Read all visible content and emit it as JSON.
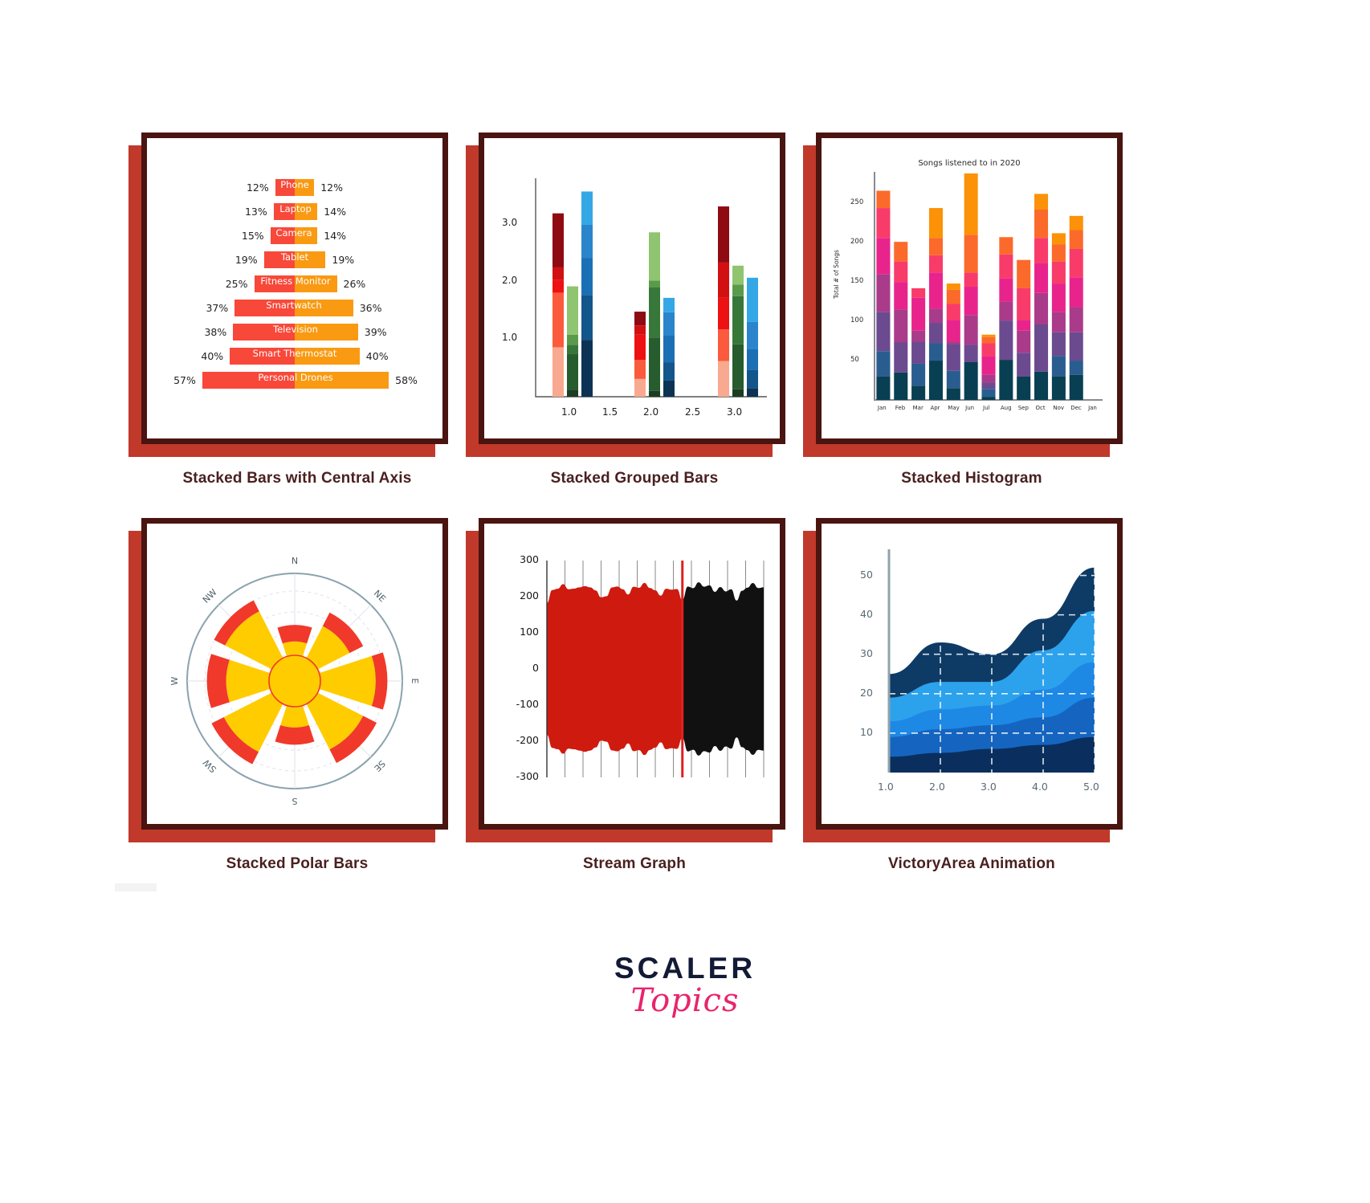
{
  "page": {
    "background": "#ffffff",
    "frame_color": "#4a1410",
    "shadow_color": "#c0392b",
    "caption_color": "#4a2020"
  },
  "logo": {
    "primary": "SCALER",
    "secondary": "Topics",
    "primary_color": "#121a35",
    "secondary_color": "#e8246c"
  },
  "cards": [
    {
      "caption": "Stacked Bars with Central Axis"
    },
    {
      "caption": "Stacked Grouped Bars"
    },
    {
      "caption": "Stacked Histogram"
    },
    {
      "caption": "Stacked Polar Bars"
    },
    {
      "caption": "Stream Graph"
    },
    {
      "caption": "VictoryArea Animation"
    }
  ],
  "chart_data": [
    {
      "type": "bar",
      "title": "Stacked Bars with Central Axis",
      "orientation": "horizontal-diverging",
      "categories": [
        "Phone",
        "Laptop",
        "Camera",
        "Tablet",
        "Fitness Monitor",
        "Smartwatch",
        "Television",
        "Smart Thermostat",
        "Personal Drones"
      ],
      "series": [
        {
          "name": "left",
          "color": "#f8483a",
          "values": [
            12,
            13,
            15,
            19,
            25,
            37,
            38,
            40,
            57
          ]
        },
        {
          "name": "right",
          "color": "#f99a12",
          "values": [
            12,
            14,
            14,
            19,
            26,
            36,
            39,
            40,
            58
          ]
        }
      ],
      "left_labels": [
        "12%",
        "13%",
        "15%",
        "19%",
        "25%",
        "37%",
        "38%",
        "40%",
        "57%"
      ],
      "right_labels": [
        "12%",
        "14%",
        "14%",
        "19%",
        "26%",
        "36%",
        "39%",
        "40%",
        "58%"
      ],
      "xlabel": "",
      "ylabel": "",
      "grid": false,
      "legend": "none"
    },
    {
      "type": "bar",
      "title": "Stacked Grouped Bars",
      "xlabel": "",
      "ylabel": "",
      "x_ticks": [
        "1.0",
        "1.5",
        "2.0",
        "2.5",
        "3.0"
      ],
      "y_ticks": [
        "1.0",
        "2.0",
        "3.0"
      ],
      "ylim": [
        0,
        3.8
      ],
      "grid": false,
      "legend": "none",
      "groups": [
        {
          "x": "1.0",
          "bars": [
            {
              "name": "red",
              "segments": [
                0.86,
                0.95,
                0.22,
                0.22,
                0.94
              ],
              "colors": [
                "#f9a98f",
                "#fb5a3c",
                "#ee1111",
                "#d21012",
                "#8e0b12"
              ]
            },
            {
              "name": "green",
              "segments": [
                0.12,
                0.62,
                0.16,
                0.18,
                0.84
              ],
              "colors": [
                "#1b3d23",
                "#265c2e",
                "#37783a",
                "#5a9b4b",
                "#8fc470"
              ]
            },
            {
              "name": "blue",
              "segments": [
                0.99,
                0.78,
                0.64,
                0.58,
                0.58
              ],
              "colors": [
                "#0d3354",
                "#13568b",
                "#1b6fb5",
                "#2a85cc",
                "#34a8e6"
              ]
            }
          ]
        },
        {
          "x": "2.0",
          "bars": [
            {
              "name": "red",
              "segments": [
                0.31,
                0.33,
                0.44,
                0.16,
                0.24
              ],
              "colors": [
                "#f9a98f",
                "#fb5a3c",
                "#ee1111",
                "#d21012",
                "#8e0b12"
              ]
            },
            {
              "name": "green",
              "segments": [
                0.1,
                0.92,
                0.88,
                0.12,
                0.84
              ],
              "colors": [
                "#1b3d23",
                "#265c2e",
                "#37783a",
                "#5a9b4b",
                "#8fc470"
              ]
            },
            {
              "name": "blue",
              "segments": [
                0.28,
                0.32,
                0.47,
                0.4,
                0.25
              ],
              "colors": [
                "#0d3354",
                "#13568b",
                "#1b6fb5",
                "#2a85cc",
                "#34a8e6"
              ]
            }
          ]
        },
        {
          "x": "3.0",
          "bars": [
            {
              "name": "red",
              "segments": [
                0.62,
                0.55,
                0.55,
                0.62,
                0.97
              ],
              "colors": [
                "#f9a98f",
                "#fb5a3c",
                "#ee1111",
                "#d21012",
                "#8e0b12"
              ]
            },
            {
              "name": "green",
              "segments": [
                0.13,
                0.78,
                0.84,
                0.2,
                0.33
              ],
              "colors": [
                "#1b3d23",
                "#265c2e",
                "#37783a",
                "#5a9b4b",
                "#8fc470"
              ]
            },
            {
              "name": "blue",
              "segments": [
                0.15,
                0.32,
                0.36,
                0.47,
                0.77
              ],
              "colors": [
                "#0d3354",
                "#13568b",
                "#1b6fb5",
                "#2a85cc",
                "#34a8e6"
              ]
            }
          ]
        }
      ]
    },
    {
      "type": "bar",
      "title": "Songs listened to in 2020",
      "ylabel": "Total # of Songs",
      "xlabel": "",
      "categories": [
        "Jan",
        "Feb",
        "Mar",
        "Apr",
        "May",
        "Jun",
        "Jul",
        "Aug",
        "Sep",
        "Oct",
        "Nov",
        "Dec",
        "Jan"
      ],
      "y_ticks": [
        "50",
        "100",
        "150",
        "200",
        "250"
      ],
      "ylim": [
        0,
        290
      ],
      "grid": false,
      "legend": "none",
      "stack_colors": [
        "#093f52",
        "#2a5d8f",
        "#6b4a8f",
        "#a93b8a",
        "#e8248c",
        "#f93b6a",
        "#fb6a2a",
        "#fb9208"
      ],
      "stacks": [
        [
          30,
          32,
          50,
          48,
          46,
          38,
          22,
          0
        ],
        [
          35,
          0,
          38,
          42,
          35,
          26,
          25,
          0
        ],
        [
          18,
          28,
          28,
          14,
          42,
          12,
          0,
          0
        ],
        [
          50,
          22,
          26,
          18,
          46,
          22,
          22,
          38
        ],
        [
          15,
          22,
          34,
          3,
          28,
          20,
          18,
          8
        ],
        [
          48,
          0,
          22,
          38,
          36,
          18,
          48,
          78
        ],
        [
          4,
          10,
          8,
          10,
          24,
          16,
          8,
          3
        ],
        [
          51,
          0,
          50,
          24,
          30,
          30,
          22,
          0
        ],
        [
          30,
          0,
          30,
          28,
          14,
          40,
          36,
          0
        ],
        [
          36,
          0,
          60,
          40,
          38,
          32,
          36,
          20
        ],
        [
          30,
          26,
          30,
          26,
          36,
          28,
          22,
          14
        ],
        [
          32,
          18,
          36,
          32,
          38,
          36,
          24,
          18
        ],
        [
          0,
          0,
          0,
          0,
          0,
          0,
          0,
          0
        ]
      ]
    },
    {
      "type": "bar",
      "title": "Stacked Polar Bars",
      "coordinate": "polar",
      "directions": [
        "N",
        "NE",
        "E",
        "SE",
        "S",
        "SW",
        "W",
        "NW"
      ],
      "series": [
        {
          "name": "inner",
          "color": "#ffcc00",
          "values": [
            0.2,
            0.52,
            0.8,
            0.74,
            0.3,
            0.78,
            0.62,
            0.76
          ]
        },
        {
          "name": "outer",
          "color": "#f0392b",
          "values": [
            0.24,
            0.22,
            0.17,
            0.22,
            0.25,
            0.2,
            0.28,
            0.18
          ]
        }
      ],
      "grid": true,
      "legend": "none"
    },
    {
      "type": "area",
      "title": "Stream Graph",
      "y_ticks": [
        "300",
        "200",
        "100",
        "0",
        "-100",
        "-200",
        "-300"
      ],
      "ylim": [
        -300,
        300
      ],
      "xlabel": "",
      "ylabel": "",
      "grid": true,
      "legend": "none",
      "marker_line_color": "#e02020",
      "palette_left": [
        "#cf1a0f",
        "#f23a10",
        "#f7e04a",
        "#a5d44a",
        "#4fae4a",
        "#1d8a6e",
        "#10695c",
        "#0c5046"
      ],
      "palette_right": [
        "#111111",
        "#2d2d2d",
        "#4a4a4a",
        "#6b6b6b",
        "#8a8a8a",
        "#ababab",
        "#cccccc",
        "#eeeeee"
      ]
    },
    {
      "type": "area",
      "title": "VictoryArea Animation",
      "x_ticks": [
        "1.0",
        "2.0",
        "3.0",
        "4.0",
        "5.0"
      ],
      "y_ticks": [
        "10",
        "20",
        "30",
        "40",
        "50"
      ],
      "xlim": [
        1,
        5
      ],
      "ylim": [
        0,
        55
      ],
      "grid": true,
      "grid_color": "#ffffff",
      "grid_style": "dashed",
      "legend": "none",
      "series": [
        {
          "name": "s1",
          "color": "#0a2f5e",
          "values": [
            4,
            5,
            6,
            7,
            9
          ]
        },
        {
          "name": "s2",
          "color": "#1565c0",
          "values": [
            5,
            6,
            6,
            7,
            10
          ]
        },
        {
          "name": "s3",
          "color": "#1e88e5",
          "values": [
            4,
            5,
            5,
            7,
            9
          ]
        },
        {
          "name": "s4",
          "color": "#2da2ec",
          "values": [
            6,
            7,
            6,
            10,
            13
          ]
        },
        {
          "name": "s5",
          "color": "#0d3b66",
          "values": [
            6,
            10,
            7,
            8,
            11
          ]
        }
      ]
    }
  ]
}
